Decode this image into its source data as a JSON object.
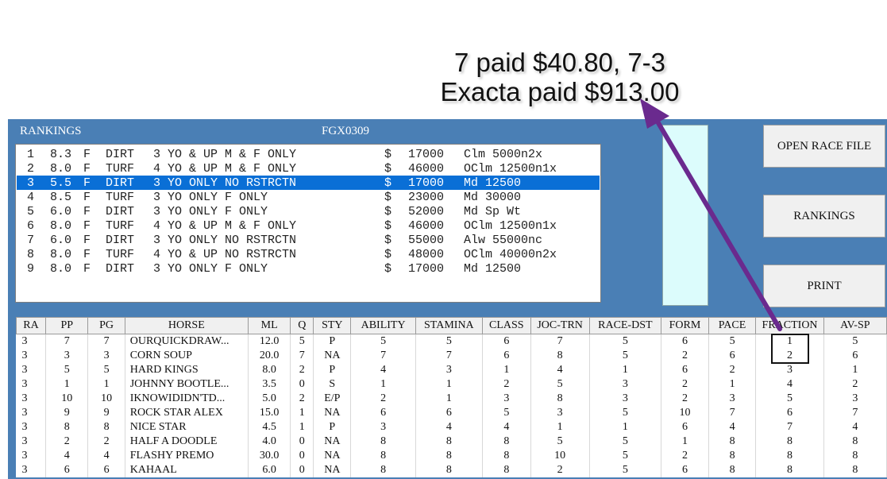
{
  "annotation": {
    "line1": "7 paid $40.80, 7-3",
    "line2": "Exacta paid $913.00"
  },
  "header": {
    "rankings_label": "RANKINGS",
    "file_code": "FGX0309"
  },
  "races": [
    {
      "num": "1",
      "dist": "8.3",
      "surf_code": "F",
      "surface": "DIRT",
      "conditions": "3 YO & UP M & F ONLY",
      "currency": "$",
      "purse": "17000",
      "type": "Clm 5000n2x"
    },
    {
      "num": "2",
      "dist": "8.0",
      "surf_code": "F",
      "surface": "TURF",
      "conditions": "4 YO & UP M & F ONLY",
      "currency": "$",
      "purse": "46000",
      "type": "OClm 12500n1x"
    },
    {
      "num": "3",
      "dist": "5.5",
      "surf_code": "F",
      "surface": "DIRT",
      "conditions": "3 YO ONLY NO RSTRCTN",
      "currency": "$",
      "purse": "17000",
      "type": "Md 12500"
    },
    {
      "num": "4",
      "dist": "8.5",
      "surf_code": "F",
      "surface": "TURF",
      "conditions": "3 YO ONLY F ONLY",
      "currency": "$",
      "purse": "23000",
      "type": "Md 30000"
    },
    {
      "num": "5",
      "dist": "6.0",
      "surf_code": "F",
      "surface": "DIRT",
      "conditions": "3 YO ONLY F ONLY",
      "currency": "$",
      "purse": "52000",
      "type": "Md Sp Wt"
    },
    {
      "num": "6",
      "dist": "8.0",
      "surf_code": "F",
      "surface": "TURF",
      "conditions": "4 YO & UP M & F ONLY",
      "currency": "$",
      "purse": "46000",
      "type": "OClm 12500n1x"
    },
    {
      "num": "7",
      "dist": "6.0",
      "surf_code": "F",
      "surface": "DIRT",
      "conditions": "3 YO ONLY NO RSTRCTN",
      "currency": "$",
      "purse": "55000",
      "type": "Alw 55000nc"
    },
    {
      "num": "8",
      "dist": "8.0",
      "surf_code": "F",
      "surface": "TURF",
      "conditions": "4 YO & UP NO RSTRCTN",
      "currency": "$",
      "purse": "48000",
      "type": "OClm 40000n2x"
    },
    {
      "num": "9",
      "dist": "8.0",
      "surf_code": "F",
      "surface": "DIRT",
      "conditions": "3 YO ONLY F ONLY",
      "currency": "$",
      "purse": "17000",
      "type": "Md 12500"
    }
  ],
  "selected_race_index": 2,
  "buttons": {
    "open": "OPEN RACE FILE",
    "rankings": "RANKINGS",
    "print": "PRINT"
  },
  "columns": [
    "RA",
    "PP",
    "PG",
    "HORSE",
    "ML",
    "Q",
    "STY",
    "ABILITY",
    "STAMINA",
    "CLASS",
    "JOC-TRN",
    "RACE-DST",
    "FORM",
    "PACE",
    "FRACTION",
    "AV-SP"
  ],
  "rows": [
    [
      "3",
      "7",
      "7",
      "OURQUICKDRAW...",
      "12.0",
      "5",
      "P",
      "5",
      "5",
      "6",
      "7",
      "5",
      "6",
      "5",
      "1",
      "5"
    ],
    [
      "3",
      "3",
      "3",
      "CORN SOUP",
      "20.0",
      "7",
      "NA",
      "7",
      "7",
      "6",
      "8",
      "5",
      "2",
      "6",
      "2",
      "6"
    ],
    [
      "3",
      "5",
      "5",
      "HARD KINGS",
      "8.0",
      "2",
      "P",
      "4",
      "3",
      "1",
      "4",
      "1",
      "6",
      "2",
      "3",
      "1"
    ],
    [
      "3",
      "1",
      "1",
      "JOHNNY BOOTLE...",
      "3.5",
      "0",
      "S",
      "1",
      "1",
      "2",
      "5",
      "3",
      "2",
      "1",
      "4",
      "2"
    ],
    [
      "3",
      "10",
      "10",
      "IKNOWIDIDN'TD...",
      "5.0",
      "2",
      "E/P",
      "2",
      "1",
      "3",
      "8",
      "3",
      "2",
      "3",
      "5",
      "3"
    ],
    [
      "3",
      "9",
      "9",
      "ROCK STAR ALEX",
      "15.0",
      "1",
      "NA",
      "6",
      "6",
      "5",
      "3",
      "5",
      "10",
      "7",
      "6",
      "7"
    ],
    [
      "3",
      "8",
      "8",
      "NICE STAR",
      "4.5",
      "1",
      "P",
      "3",
      "4",
      "4",
      "1",
      "1",
      "6",
      "4",
      "7",
      "4"
    ],
    [
      "3",
      "2",
      "2",
      "HALF A DOODLE",
      "4.0",
      "0",
      "NA",
      "8",
      "8",
      "8",
      "5",
      "5",
      "1",
      "8",
      "8",
      "8"
    ],
    [
      "3",
      "4",
      "4",
      "FLASHY PREMO",
      "30.0",
      "0",
      "NA",
      "8",
      "8",
      "8",
      "10",
      "5",
      "2",
      "8",
      "8",
      "8"
    ],
    [
      "3",
      "6",
      "6",
      "KAHAAL",
      "6.0",
      "0",
      "NA",
      "8",
      "8",
      "8",
      "2",
      "5",
      "6",
      "8",
      "8",
      "8"
    ]
  ],
  "colors": {
    "panel": "#4a7fb5",
    "selection": "#0a6fd6",
    "arrow": "#6a2a8e",
    "cyan_box": "#dcfcfc"
  }
}
